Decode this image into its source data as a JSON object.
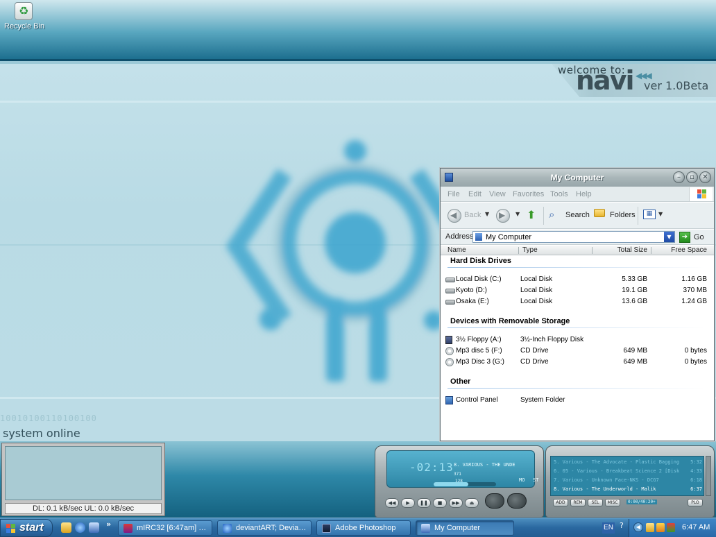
{
  "desktop": {
    "icons": [
      {
        "label": "Recycle Bin",
        "icon": "recycle-bin-icon"
      }
    ],
    "banner": {
      "welcome": "welcome to:",
      "logo": "navi",
      "version": "ver 1.0Beta"
    },
    "status": {
      "binary": "10010100110100100",
      "text": "system online"
    },
    "net_meter": "DL: 0.1 kB/sec  UL: 0.0 kB/sec"
  },
  "window": {
    "title": "My Computer",
    "menu": [
      "File",
      "Edit",
      "View",
      "Favorites",
      "Tools",
      "Help"
    ],
    "toolbar": {
      "back": "Back",
      "search": "Search",
      "folders": "Folders"
    },
    "address": {
      "label": "Address",
      "value": "My Computer",
      "go": "Go"
    },
    "columns": [
      "Name",
      "Type",
      "Total Size",
      "Free Space"
    ],
    "groups": [
      {
        "title": "Hard Disk Drives",
        "items": [
          {
            "icon": "hard-disk-icon",
            "name": "Local Disk (C:)",
            "type": "Local Disk",
            "total": "5.33 GB",
            "free": "1.16 GB"
          },
          {
            "icon": "hard-disk-icon",
            "name": "Kyoto (D:)",
            "type": "Local Disk",
            "total": "19.1 GB",
            "free": "370 MB"
          },
          {
            "icon": "hard-disk-icon",
            "name": "Osaka (E:)",
            "type": "Local Disk",
            "total": "13.6 GB",
            "free": "1.24 GB"
          }
        ]
      },
      {
        "title": "Devices with Removable Storage",
        "items": [
          {
            "icon": "floppy-icon",
            "name": "3½ Floppy (A:)",
            "type": "3½-Inch Floppy Disk",
            "total": "",
            "free": ""
          },
          {
            "icon": "cd-drive-icon",
            "name": "Mp3 disc 5 (F:)",
            "type": "CD Drive",
            "total": "649 MB",
            "free": "0 bytes"
          },
          {
            "icon": "cd-drive-icon",
            "name": "Mp3 Disc 3 (G:)",
            "type": "CD Drive",
            "total": "649 MB",
            "free": "0 bytes"
          }
        ]
      },
      {
        "title": "Other",
        "items": [
          {
            "icon": "control-panel-icon",
            "name": "Control Panel",
            "type": "System Folder",
            "total": "",
            "free": ""
          }
        ]
      }
    ]
  },
  "player": {
    "time": "-02:13",
    "track": "8. VARIOUS - THE UNDE",
    "kbps": "371",
    "khz": "128",
    "mode_mono": "MO",
    "mode_stereo": "ST",
    "volume": 0.55
  },
  "playlist": {
    "entries": [
      {
        "title": "5. Various - The Advocate - Plastic Bagging",
        "duration": "5:32",
        "current": false
      },
      {
        "title": "6. 05 - Various - Breakbeat Science 2 [Disk 1] - A...",
        "duration": "4:33",
        "current": false
      },
      {
        "title": "7. Various - Unknown Face-NKS - DCG7",
        "duration": "6:18",
        "current": false
      },
      {
        "title": "8. Various - The Underworld - Malik",
        "duration": "6:37",
        "current": true
      }
    ],
    "buttons": [
      "ADD",
      "REM",
      "SEL",
      "MISC",
      "PLO"
    ],
    "time": "0:00/40:20+"
  },
  "taskbar": {
    "start": "start",
    "tasks": [
      {
        "label": "mIRC32 [6:47am] [ ...",
        "icon": "mirc-icon",
        "active": false
      },
      {
        "label": "deviantART; Deviatio...",
        "icon": "ie-icon",
        "active": false
      },
      {
        "label": "Adobe Photoshop",
        "icon": "photoshop-icon",
        "active": false
      },
      {
        "label": "My Computer",
        "icon": "my-computer-icon",
        "active": true
      }
    ],
    "language": "EN",
    "clock": "6:47 AM"
  }
}
